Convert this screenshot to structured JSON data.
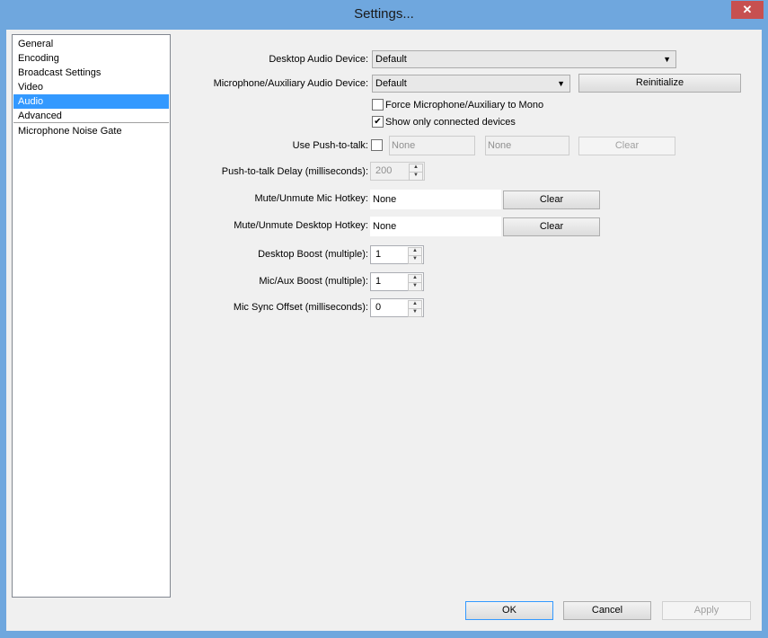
{
  "window": {
    "title": "Settings...",
    "close_glyph": "✕"
  },
  "sidebar": {
    "items": [
      {
        "label": "General"
      },
      {
        "label": "Encoding"
      },
      {
        "label": "Broadcast Settings"
      },
      {
        "label": "Video"
      },
      {
        "label": "Audio",
        "selected": true
      },
      {
        "label": "Advanced"
      },
      {
        "label": "Microphone Noise Gate"
      }
    ]
  },
  "audio": {
    "desktop_device": {
      "label": "Desktop Audio Device:",
      "value": "Default"
    },
    "mic_device": {
      "label": "Microphone/Auxiliary Audio Device:",
      "value": "Default"
    },
    "reinitialize_label": "Reinitialize",
    "force_mono": {
      "label": "Force Microphone/Auxiliary to Mono",
      "checked": false
    },
    "show_connected": {
      "label": "Show only connected devices",
      "checked": true
    },
    "push_to_talk": {
      "label": "Use Push-to-talk:",
      "checked": false,
      "hotkey1": "None",
      "hotkey2": "None",
      "clear_label": "Clear"
    },
    "ptt_delay": {
      "label": "Push-to-talk Delay (milliseconds):",
      "value": "200"
    },
    "mute_mic": {
      "label": "Mute/Unmute Mic Hotkey:",
      "value": "None",
      "clear_label": "Clear"
    },
    "mute_desktop": {
      "label": "Mute/Unmute Desktop Hotkey:",
      "value": "None",
      "clear_label": "Clear"
    },
    "desktop_boost": {
      "label": "Desktop Boost (multiple):",
      "value": "1"
    },
    "mic_boost": {
      "label": "Mic/Aux Boost (multiple):",
      "value": "1"
    },
    "mic_sync": {
      "label": "Mic Sync Offset (milliseconds):",
      "value": "0"
    }
  },
  "footer": {
    "ok_label": "OK",
    "cancel_label": "Cancel",
    "apply_label": "Apply"
  },
  "colors": {
    "selection": "#3399ff",
    "title_bar": "#6fa7de",
    "close_button": "#c75050"
  }
}
